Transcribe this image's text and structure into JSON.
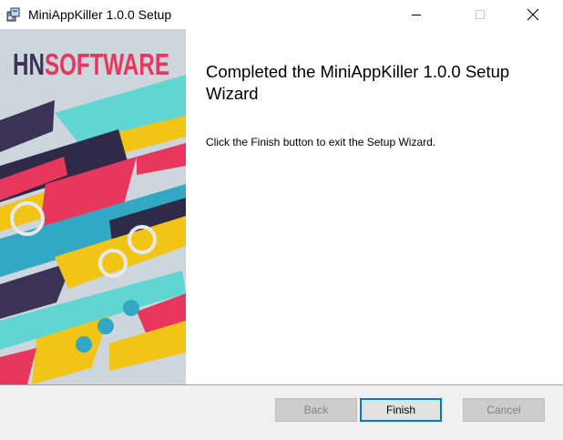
{
  "window": {
    "title": "MiniAppKiller 1.0.0 Setup"
  },
  "banner": {
    "brand_prefix": "HN",
    "brand_suffix": "SOFTWARE",
    "colors": {
      "brand_dark": "#3a3355",
      "brand_accent": "#e8375d"
    }
  },
  "content": {
    "heading": "Completed the MiniAppKiller 1.0.0 Setup Wizard",
    "description": "Click the Finish button to exit the Setup Wizard."
  },
  "buttons": {
    "back": "Back",
    "finish": "Finish",
    "cancel": "Cancel"
  },
  "icons": {
    "app": "installer-icon",
    "minimize": "minimize-icon",
    "maximize": "maximize-icon",
    "close": "close-icon"
  },
  "colors": {
    "focus_border": "#0078d7",
    "bottom_bar": "#f0f0f0"
  }
}
